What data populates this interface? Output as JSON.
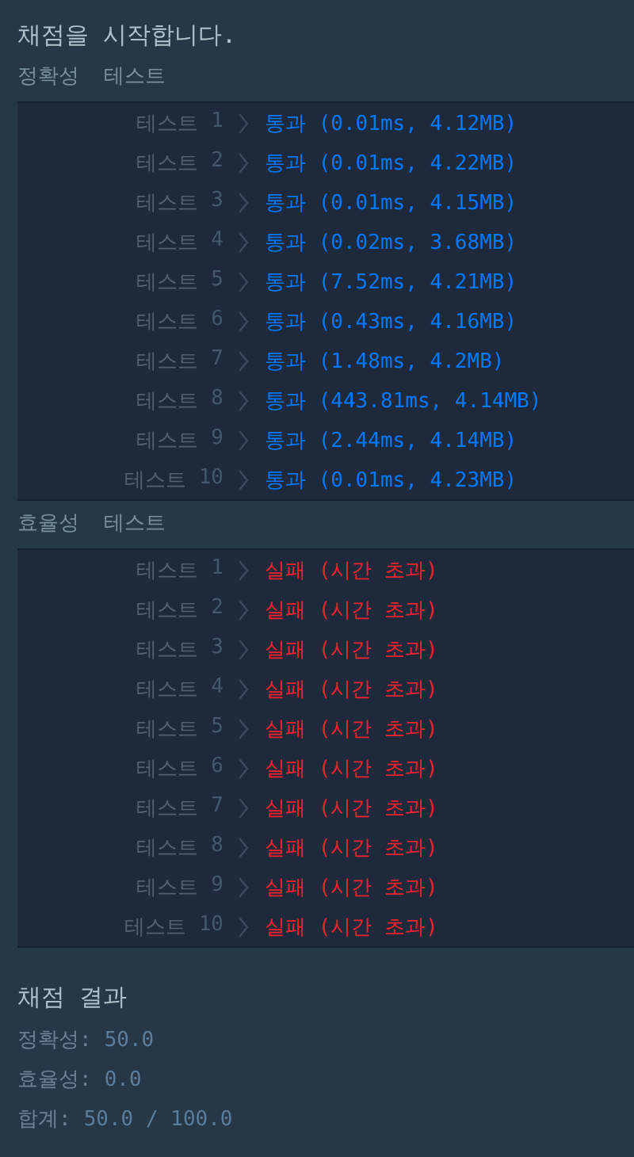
{
  "title": "채점을 시작합니다.",
  "sections": [
    {
      "heading": "정확성  테스트",
      "tests": [
        {
          "label": "테스트",
          "number": "1",
          "kind": "pass",
          "result": "통과 (0.01ms, 4.12MB)"
        },
        {
          "label": "테스트",
          "number": "2",
          "kind": "pass",
          "result": "통과 (0.01ms, 4.22MB)"
        },
        {
          "label": "테스트",
          "number": "3",
          "kind": "pass",
          "result": "통과 (0.01ms, 4.15MB)"
        },
        {
          "label": "테스트",
          "number": "4",
          "kind": "pass",
          "result": "통과 (0.02ms, 3.68MB)"
        },
        {
          "label": "테스트",
          "number": "5",
          "kind": "pass",
          "result": "통과 (7.52ms, 4.21MB)"
        },
        {
          "label": "테스트",
          "number": "6",
          "kind": "pass",
          "result": "통과 (0.43ms, 4.16MB)"
        },
        {
          "label": "테스트",
          "number": "7",
          "kind": "pass",
          "result": "통과 (1.48ms, 4.2MB)"
        },
        {
          "label": "테스트",
          "number": "8",
          "kind": "pass",
          "result": "통과 (443.81ms, 4.14MB)"
        },
        {
          "label": "테스트",
          "number": "9",
          "kind": "pass",
          "result": "통과 (2.44ms, 4.14MB)"
        },
        {
          "label": "테스트",
          "number": "10",
          "kind": "pass",
          "result": "통과 (0.01ms, 4.23MB)"
        }
      ]
    },
    {
      "heading": "효율성  테스트",
      "tests": [
        {
          "label": "테스트",
          "number": "1",
          "kind": "fail",
          "result": "실패 (시간 초과)"
        },
        {
          "label": "테스트",
          "number": "2",
          "kind": "fail",
          "result": "실패 (시간 초과)"
        },
        {
          "label": "테스트",
          "number": "3",
          "kind": "fail",
          "result": "실패 (시간 초과)"
        },
        {
          "label": "테스트",
          "number": "4",
          "kind": "fail",
          "result": "실패 (시간 초과)"
        },
        {
          "label": "테스트",
          "number": "5",
          "kind": "fail",
          "result": "실패 (시간 초과)"
        },
        {
          "label": "테스트",
          "number": "6",
          "kind": "fail",
          "result": "실패 (시간 초과)"
        },
        {
          "label": "테스트",
          "number": "7",
          "kind": "fail",
          "result": "실패 (시간 초과)"
        },
        {
          "label": "테스트",
          "number": "8",
          "kind": "fail",
          "result": "실패 (시간 초과)"
        },
        {
          "label": "테스트",
          "number": "9",
          "kind": "fail",
          "result": "실패 (시간 초과)"
        },
        {
          "label": "테스트",
          "number": "10",
          "kind": "fail",
          "result": "실패 (시간 초과)"
        }
      ]
    }
  ],
  "summary": {
    "title": "채점 결과",
    "lines": [
      {
        "label": "정확성:",
        "value": "50.0"
      },
      {
        "label": "효율성:",
        "value": "0.0"
      },
      {
        "label": "합계:",
        "value": "50.0 / 100.0"
      }
    ]
  }
}
